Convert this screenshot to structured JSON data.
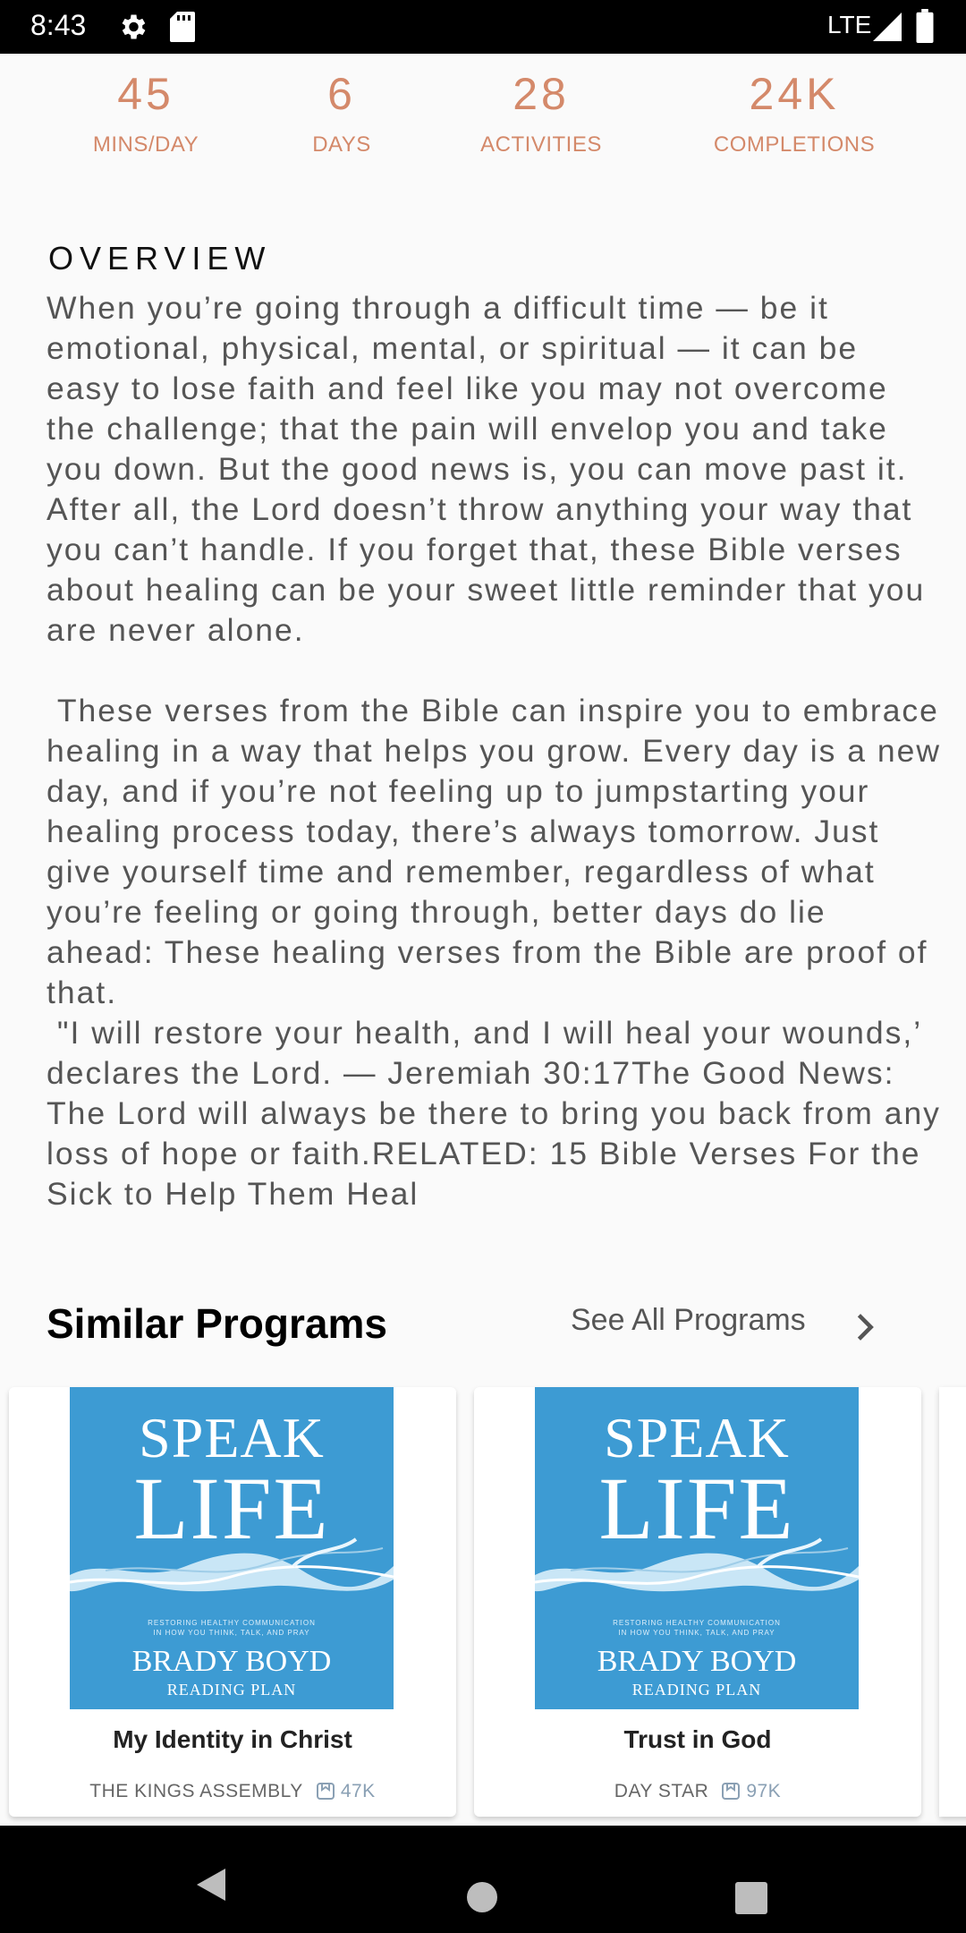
{
  "status_bar": {
    "time": "8:43",
    "network": "LTE"
  },
  "stats": [
    {
      "value": "45",
      "label": "MINS/DAY"
    },
    {
      "value": "6",
      "label": "DAYS"
    },
    {
      "value": "28",
      "label": "ACTIVITIES"
    },
    {
      "value": "24K",
      "label": "COMPLETIONS"
    }
  ],
  "overview": {
    "title": "OVERVIEW",
    "body": "When you’re going through a difficult time — be it emotional, physical, mental, or spiritual — it can be easy to lose faith and feel like you may not overcome the challenge; that the pain will envelop you and take you down. But the good news is, you can move past it. After all, the Lord doesn’t throw anything your way that you can’t handle. If you forget that, these Bible verses about healing can be your sweet little reminder that you are never alone.\n\n These verses from the Bible can inspire you to embrace healing in a way that helps you grow. Every day is a new day, and if you’re not feeling up to jumpstarting your healing process today, there’s always tomorrow. Just give yourself time and remember, regardless of what you’re feeling or going through, better days do lie ahead: These healing verses from the Bible are proof of that.\n \"I will restore your health, and I will heal your wounds,’ declares the Lord. — Jeremiah 30:17The Good News: The Lord will always be there to bring you back from any loss of hope or faith.RELATED: 15 Bible Verses For the Sick to Help Them Heal"
  },
  "similar": {
    "title": "Similar Programs",
    "see_all": "See All Programs",
    "cards": [
      {
        "title": "My Identity in Christ",
        "author": "THE KINGS ASSEMBLY",
        "count": "47K",
        "cover": {
          "line1": "SPEAK",
          "line2": "LIFE",
          "fine": "RESTORING HEALTHY COMMUNICATION\nIN HOW YOU THINK, TALK, AND PRAY",
          "author": "BRADY BOYD",
          "subtitle": "READING PLAN"
        }
      },
      {
        "title": "Trust in God",
        "author": "DAY STAR",
        "count": "97K",
        "cover": {
          "line1": "SPEAK",
          "line2": "LIFE",
          "fine": "RESTORING HEALTHY COMMUNICATION\nIN HOW YOU THINK, TALK, AND PRAY",
          "author": "BRADY BOYD",
          "subtitle": "READING PLAN"
        }
      }
    ]
  },
  "colors": {
    "accent": "#d4896a",
    "cover_blue": "#3d9bd3",
    "count_blue": "#8aa0b4"
  },
  "icons": [
    "gear-icon",
    "sd-card-icon",
    "signal-icon",
    "battery-icon",
    "chevron-right-icon",
    "bookmark-icon",
    "back-icon",
    "home-icon",
    "recents-icon"
  ]
}
